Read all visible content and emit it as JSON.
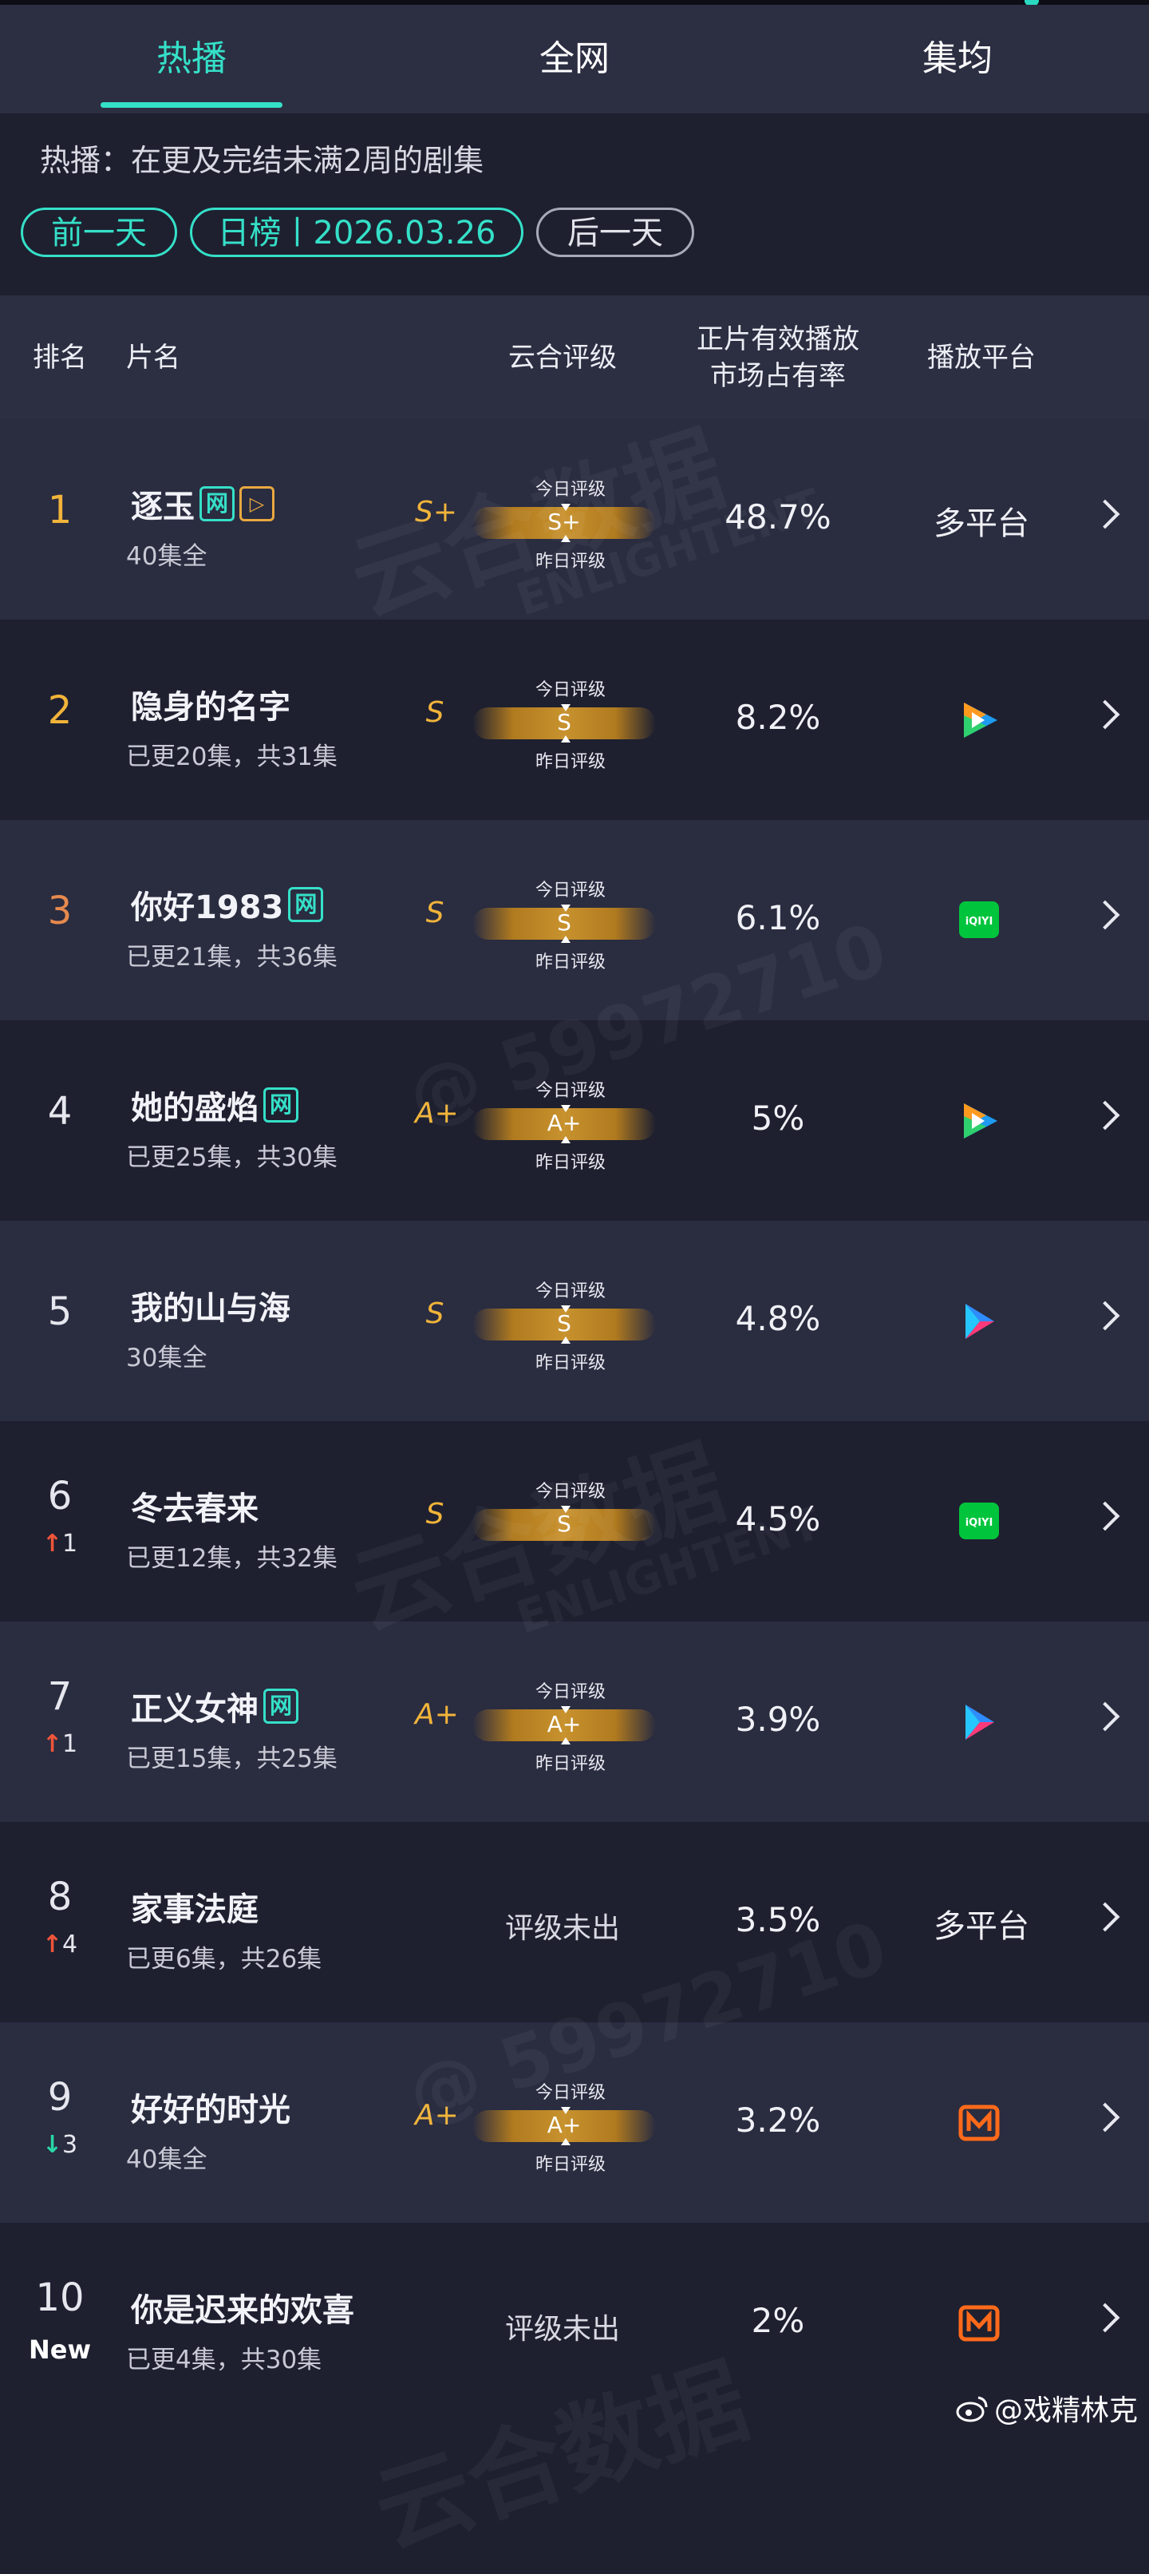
{
  "tabs": [
    {
      "label": "热播",
      "active": true
    },
    {
      "label": "全网",
      "active": false
    },
    {
      "label": "集均",
      "active": false
    }
  ],
  "subtitle": "热播：在更及完结未满2周的剧集",
  "date_nav": {
    "prev": "前一天",
    "current": "日榜丨2026.03.26",
    "next": "后一天"
  },
  "table_headers": {
    "rank": "排名",
    "title": "片名",
    "grade": "云合评级",
    "share_line1": "正片有效播放",
    "share_line2": "市场占有率",
    "platform": "播放平台"
  },
  "grade_labels": {
    "today": "今日评级",
    "yesterday": "昨日评级",
    "none": "评级未出"
  },
  "watermark": {
    "brand": "云合数据",
    "brand_en": "ENLIGHTENT",
    "id": "@ 59972710"
  },
  "rows": [
    {
      "rank": "1",
      "title": "逐玉",
      "net_badge": "网",
      "vip_badge": "▷",
      "episodes": "40集全",
      "grade": "S+",
      "grade_today": "S+",
      "share": "48.7%",
      "platform": "多平台",
      "platform_icon": "",
      "change": "",
      "change_dir": ""
    },
    {
      "rank": "2",
      "title": "隐身的名字",
      "net_badge": "",
      "vip_badge": "",
      "episodes": "已更20集，共31集",
      "grade": "S",
      "grade_today": "S",
      "share": "8.2%",
      "platform": "",
      "platform_icon": "tencent-video-icon",
      "change": "",
      "change_dir": ""
    },
    {
      "rank": "3",
      "title": "你好1983",
      "net_badge": "网",
      "vip_badge": "",
      "episodes": "已更21集，共36集",
      "grade": "S",
      "grade_today": "S",
      "share": "6.1%",
      "platform": "",
      "platform_icon": "iqiyi-icon",
      "change": "",
      "change_dir": ""
    },
    {
      "rank": "4",
      "title": "她的盛焰",
      "net_badge": "网",
      "vip_badge": "",
      "episodes": "已更25集，共30集",
      "grade": "A+",
      "grade_today": "A+",
      "share": "5%",
      "platform": "",
      "platform_icon": "tencent-video-icon",
      "change": "",
      "change_dir": ""
    },
    {
      "rank": "5",
      "title": "我的山与海",
      "net_badge": "",
      "vip_badge": "",
      "episodes": "30集全",
      "grade": "S",
      "grade_today": "S",
      "share": "4.8%",
      "platform": "",
      "platform_icon": "youku-icon",
      "change": "",
      "change_dir": ""
    },
    {
      "rank": "6",
      "title": "冬去春来",
      "net_badge": "",
      "vip_badge": "",
      "episodes": "已更12集，共32集",
      "grade": "S",
      "grade_today": "S",
      "share": "4.5%",
      "platform": "",
      "platform_icon": "iqiyi-icon",
      "change": "1",
      "change_dir": "up",
      "today_only": true
    },
    {
      "rank": "7",
      "title": "正义女神",
      "net_badge": "网",
      "vip_badge": "",
      "episodes": "已更15集，共25集",
      "grade": "A+",
      "grade_today": "A+",
      "share": "3.9%",
      "platform": "",
      "platform_icon": "youku-icon",
      "change": "1",
      "change_dir": "up"
    },
    {
      "rank": "8",
      "title": "家事法庭",
      "net_badge": "",
      "vip_badge": "",
      "episodes": "已更6集，共26集",
      "grade": "",
      "grade_today": "",
      "share": "3.5%",
      "platform": "多平台",
      "platform_icon": "",
      "change": "4",
      "change_dir": "up"
    },
    {
      "rank": "9",
      "title": "好好的时光",
      "net_badge": "",
      "vip_badge": "",
      "episodes": "40集全",
      "grade": "A+",
      "grade_today": "A+",
      "share": "3.2%",
      "platform": "",
      "platform_icon": "mango-tv-icon",
      "change": "3",
      "change_dir": "down"
    },
    {
      "rank": "10",
      "title": "你是迟来的欢喜",
      "net_badge": "",
      "vip_badge": "",
      "episodes": "已更4集，共30集",
      "grade": "",
      "grade_today": "",
      "share": "2%",
      "platform": "",
      "platform_icon": "mango-tv-icon",
      "change": "New",
      "change_dir": "new"
    }
  ],
  "colors": {
    "accent": "#35e0c8",
    "rank_1": "#f1b43a",
    "rank_2": "#f1b43a",
    "rank_3": "#e58a4e",
    "rank_other": "#e6e7ee",
    "grade": "#f1b43a",
    "up": "#f0553a",
    "down": "#2ad6a6"
  },
  "footer": "@戏精林克"
}
